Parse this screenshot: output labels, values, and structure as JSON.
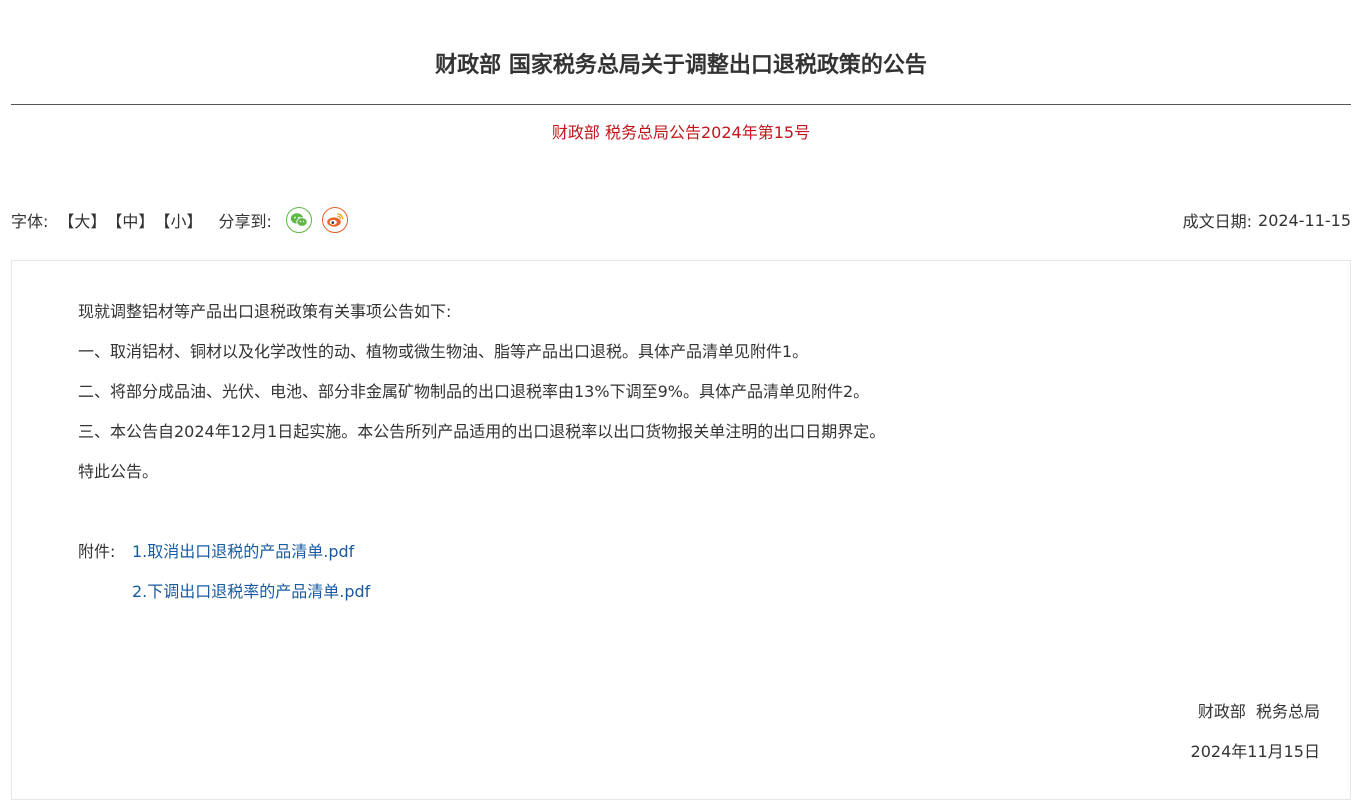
{
  "article": {
    "title": "财政部 国家税务总局关于调整出口退税政策的公告",
    "doc_number": "财政部 税务总局公告2024年第15号"
  },
  "toolbar": {
    "font_label": "字体:",
    "font_large": "【大】",
    "font_medium": "【中】",
    "font_small": "【小】",
    "share_label": "分享到:",
    "share_icons": [
      "wechat-icon",
      "weibo-icon"
    ],
    "date_label": "成文日期:",
    "date_value": "2024-11-15"
  },
  "body": {
    "paragraphs": [
      "现就调整铝材等产品出口退税政策有关事项公告如下:",
      "一、取消铝材、铜材以及化学改性的动、植物或微生物油、脂等产品出口退税。具体产品清单见附件1。",
      "二、将部分成品油、光伏、电池、部分非金属矿物制品的出口退税率由13%下调至9%。具体产品清单见附件2。",
      "三、本公告自2024年12月1日起实施。本公告所列产品适用的出口退税率以出口货物报关单注明的出口日期界定。",
      "特此公告。"
    ],
    "attachments_label": "附件:",
    "attachments": [
      "1.取消出口退税的产品清单.pdf",
      "2.下调出口退税率的产品清单.pdf"
    ],
    "signature": {
      "issuer": "财政部  税务总局",
      "date": "2024年11月15日"
    }
  },
  "colors": {
    "doc_number": "#c0161c",
    "link": "#1a5aa0",
    "wechat": "#5fb748",
    "weibo": "#e8622b"
  }
}
